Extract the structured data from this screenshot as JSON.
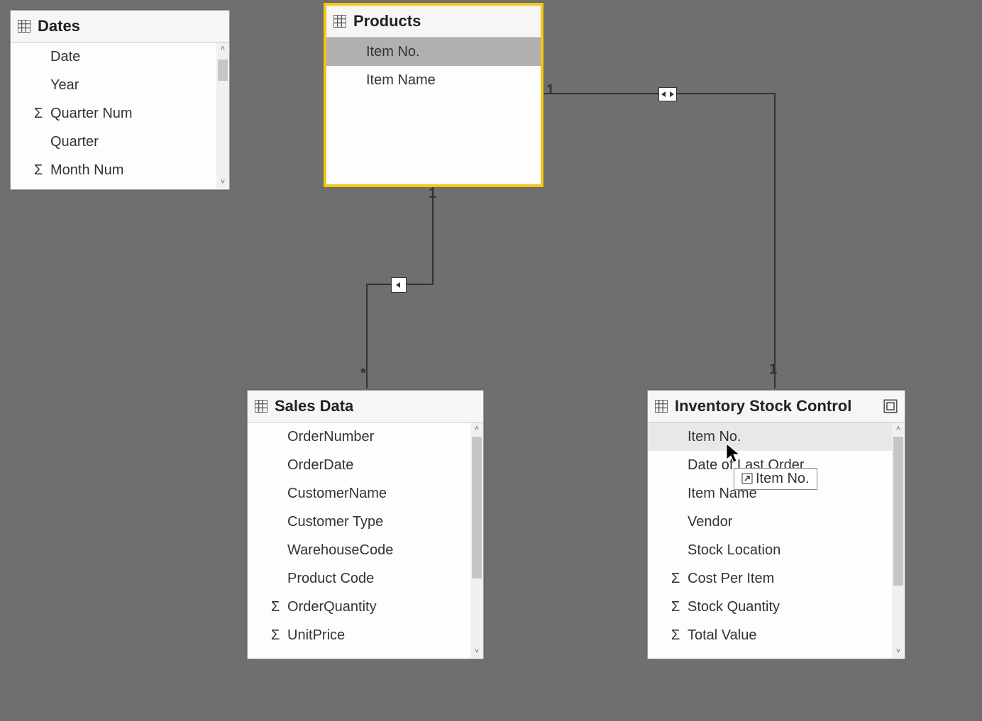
{
  "tables": {
    "dates": {
      "title": "Dates",
      "fields": [
        {
          "label": "Date",
          "agg": false
        },
        {
          "label": "Year",
          "agg": false
        },
        {
          "label": "Quarter Num",
          "agg": true
        },
        {
          "label": "Quarter",
          "agg": false
        },
        {
          "label": "Month Num",
          "agg": true
        }
      ]
    },
    "products": {
      "title": "Products",
      "fields": [
        {
          "label": "Item No.",
          "agg": false,
          "selected": true
        },
        {
          "label": "Item Name",
          "agg": false
        }
      ]
    },
    "sales": {
      "title": "Sales Data",
      "fields": [
        {
          "label": "OrderNumber",
          "agg": false
        },
        {
          "label": "OrderDate",
          "agg": false
        },
        {
          "label": "CustomerName",
          "agg": false
        },
        {
          "label": "Customer Type",
          "agg": false
        },
        {
          "label": "WarehouseCode",
          "agg": false
        },
        {
          "label": "Product Code",
          "agg": false
        },
        {
          "label": "OrderQuantity",
          "agg": true
        },
        {
          "label": "UnitPrice",
          "agg": true
        }
      ]
    },
    "inventory": {
      "title": "Inventory Stock Control",
      "fields": [
        {
          "label": "Item No.",
          "agg": false,
          "hover": true
        },
        {
          "label": "Date of Last Order",
          "agg": false
        },
        {
          "label": "Item Name",
          "agg": false
        },
        {
          "label": "Vendor",
          "agg": false
        },
        {
          "label": "Stock Location",
          "agg": false
        },
        {
          "label": "Cost Per Item",
          "agg": true
        },
        {
          "label": "Stock Quantity",
          "agg": true
        },
        {
          "label": "Total Value",
          "agg": true
        }
      ]
    }
  },
  "relations": {
    "prod_sales": {
      "from_card": "1",
      "to_card": "*",
      "direction": "single"
    },
    "prod_inv": {
      "from_card": "1",
      "to_card": "1",
      "direction": "both"
    }
  },
  "tooltip": {
    "text": "Item No."
  }
}
